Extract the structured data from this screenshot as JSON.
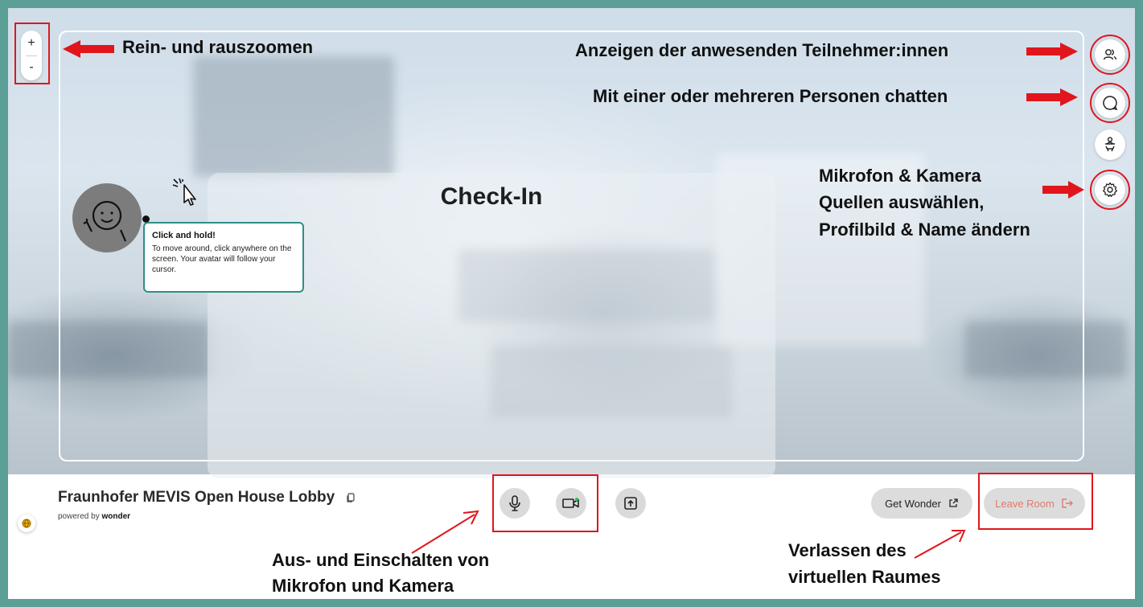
{
  "zoom": {
    "plus": "+",
    "minus": "-"
  },
  "annotations": {
    "zoom": "Rein- und rauszoomen",
    "participants": "Anzeigen der anwesenden Teilnehmer:innen",
    "chat": "Mit einer oder mehreren Personen chatten",
    "settings_line1": "Mikrofon & Kamera",
    "settings_line2": "Quellen auswählen,",
    "settings_line3": "Profilbild & Name ändern",
    "media_line1": "Aus- und Einschalten von",
    "media_line2": "Mikrofon und Kamera",
    "leave_line1": "Verlassen des",
    "leave_line2": "virtuellen Raumes"
  },
  "main": {
    "checkin_title": "Check-In"
  },
  "tooltip": {
    "title": "Click and hold!",
    "body": "To move around, click anywhere on the screen. Your avatar will follow your cursor."
  },
  "footer": {
    "room_title": "Fraunhofer MEVIS Open House Lobby",
    "powered_prefix": "powered by",
    "powered_brand": "wonder",
    "get_wonder": "Get Wonder",
    "leave_room": "Leave Room"
  },
  "colors": {
    "annotation_red": "#e0161c",
    "frame_teal": "#5c9f97",
    "tooltip_border": "#2e8f86",
    "leave_text": "#e07a6e"
  },
  "icons": [
    "participants-icon",
    "chat-icon",
    "table-icon",
    "gear-icon",
    "microphone-icon",
    "camera-icon",
    "screen-share-icon",
    "copy-icon",
    "external-link-icon",
    "exit-icon",
    "cursor-click-icon"
  ]
}
